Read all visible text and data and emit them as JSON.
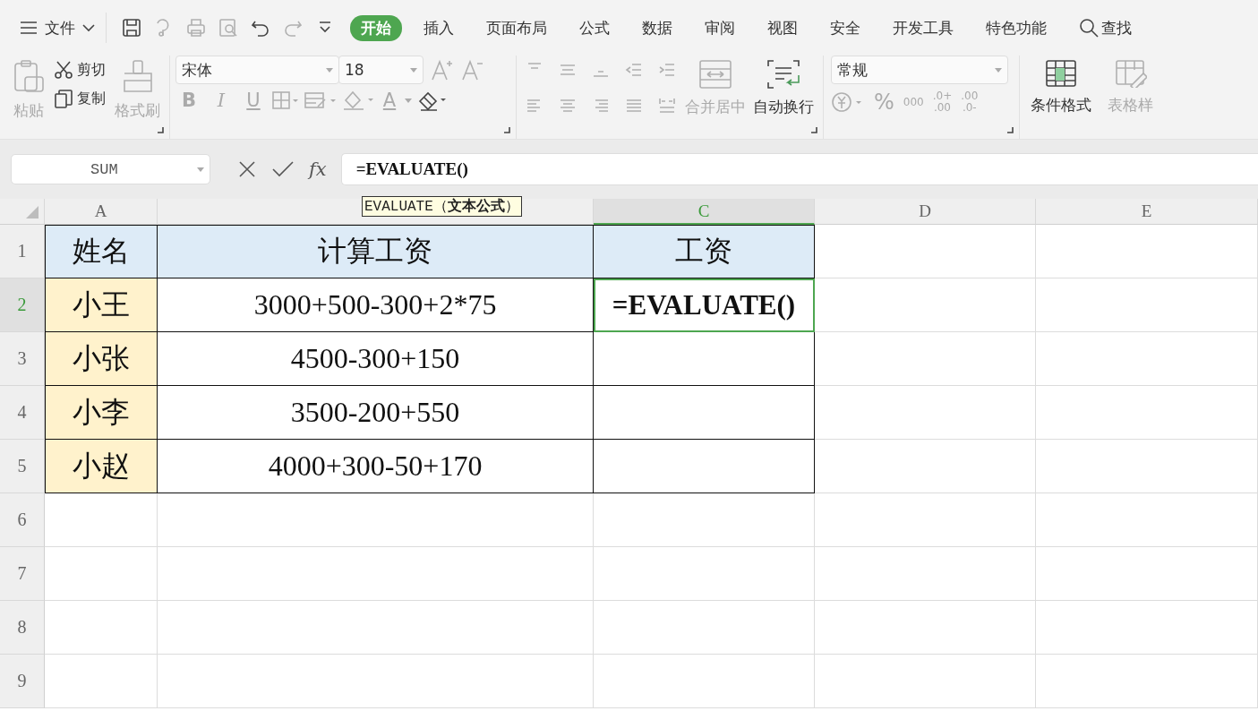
{
  "menu": {
    "label": "文件"
  },
  "tabs": [
    {
      "label": "开始",
      "selected": true
    },
    {
      "label": "插入",
      "selected": false
    },
    {
      "label": "页面布局",
      "selected": false
    },
    {
      "label": "公式",
      "selected": false
    },
    {
      "label": "数据",
      "selected": false
    },
    {
      "label": "审阅",
      "selected": false
    },
    {
      "label": "视图",
      "selected": false
    },
    {
      "label": "安全",
      "selected": false
    },
    {
      "label": "开发工具",
      "selected": false
    },
    {
      "label": "特色功能",
      "selected": false
    }
  ],
  "search": {
    "label": "查找"
  },
  "ribbon": {
    "paste": {
      "label": "粘贴",
      "disabled": true
    },
    "cut": {
      "label": "剪切",
      "disabled": false
    },
    "copy": {
      "label": "复制",
      "disabled": false
    },
    "format_painter": {
      "label": "格式刷",
      "disabled": true
    },
    "font": {
      "name": "宋体",
      "size": "18",
      "bold": "B",
      "italic": "I",
      "underline": "U",
      "font_color": "A"
    },
    "merge": {
      "label": "合并居中",
      "disabled": true
    },
    "wrap": {
      "label": "自动换行",
      "disabled": false
    },
    "number_format": {
      "value": "常规"
    },
    "percent": "%",
    "thousands": "000",
    "decimals": [
      {
        "top": ".0+",
        "bottom": ".00"
      },
      {
        "top": ".00",
        "bottom": ".0-"
      }
    ],
    "conditional": {
      "label": "条件格式",
      "disabled": false
    },
    "table_style": {
      "label": "表格样",
      "disabled": true
    }
  },
  "formula_bar": {
    "name_box": "SUM",
    "fx": "fx",
    "formula": "=EVALUATE()",
    "tooltip": "EVALUATE（**文本公式**）"
  },
  "columns": [
    {
      "label": "A",
      "selected": false
    },
    {
      "selected": false
    },
    {
      "label": "C",
      "selected": true
    },
    {
      "label": "D",
      "selected": false
    },
    {
      "label": "E",
      "selected": false
    }
  ],
  "rows": [
    {
      "label": "1",
      "selected": false,
      "cells": [
        {
          "text": "姓名",
          "kind": "header",
          "selected": false
        },
        {
          "text": "计算工资",
          "kind": "header",
          "selected": false
        },
        {
          "text": "工资",
          "kind": "header",
          "selected": false
        }
      ]
    },
    {
      "label": "2",
      "selected": true,
      "cells": [
        {
          "text": "小王",
          "kind": "name",
          "selected": false
        },
        {
          "text": "3000+500-300+2*75",
          "kind": "data",
          "selected": false
        },
        {
          "text": "=EVALUATE()",
          "kind": "editing",
          "selected": true
        }
      ]
    },
    {
      "label": "3",
      "selected": false,
      "cells": [
        {
          "text": "小张",
          "kind": "name",
          "selected": false
        },
        {
          "text": "4500-300+150",
          "kind": "data",
          "selected": false
        },
        {
          "kind": "data",
          "selected": false
        }
      ]
    },
    {
      "label": "4",
      "selected": false,
      "cells": [
        {
          "text": "小李",
          "kind": "name",
          "selected": false
        },
        {
          "text": "3500-200+550",
          "kind": "data",
          "selected": false
        },
        {
          "kind": "data",
          "selected": false
        }
      ]
    },
    {
      "label": "5",
      "selected": false,
      "cells": [
        {
          "text": "小赵",
          "kind": "name",
          "selected": false
        },
        {
          "text": "4000+300-50+170",
          "kind": "data",
          "selected": false
        },
        {
          "kind": "data",
          "selected": false
        }
      ]
    },
    {
      "label": "6",
      "selected": false
    },
    {
      "label": "7",
      "selected": false
    },
    {
      "label": "8",
      "selected": false
    },
    {
      "label": "9",
      "selected": false
    }
  ]
}
